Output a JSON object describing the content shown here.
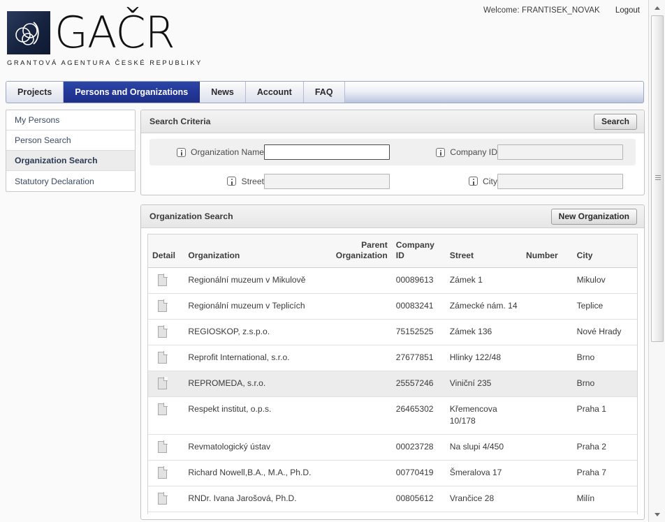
{
  "topbar": {
    "welcome_text": "Welcome: FRANTISEK_NOVAK",
    "logout_label": "Logout"
  },
  "branding": {
    "wordmark": "GAČR",
    "subtitle": "GRANTOVÁ AGENTURA ČESKÉ REPUBLIKY",
    "logo_bg": "#16233f"
  },
  "nav": {
    "active_tab_color": "#23379a",
    "tabs": [
      {
        "label": "Projects",
        "active": false
      },
      {
        "label": "Persons and Organizations",
        "active": true
      },
      {
        "label": "News",
        "active": false
      },
      {
        "label": "Account",
        "active": false
      },
      {
        "label": "FAQ",
        "active": false
      }
    ]
  },
  "sidebar": {
    "items": [
      {
        "label": "My Persons",
        "selected": false
      },
      {
        "label": "Person Search",
        "selected": false
      },
      {
        "label": "Organization Search",
        "selected": true
      },
      {
        "label": "Statutory Declaration",
        "selected": false
      }
    ]
  },
  "search_criteria": {
    "title": "Search Criteria",
    "search_button": "Search",
    "fields": {
      "organization_name": {
        "label": "Organization Name",
        "value": "",
        "placeholder": ""
      },
      "company_id": {
        "label": "Company ID",
        "value": "",
        "placeholder": ""
      },
      "street": {
        "label": "Street",
        "value": "",
        "placeholder": ""
      },
      "city": {
        "label": "City",
        "value": "",
        "placeholder": ""
      }
    }
  },
  "results": {
    "title": "Organization Search",
    "new_button": "New Organization",
    "columns": [
      "Detail",
      "Organization",
      "Parent Organization",
      "Company ID",
      "Street",
      "Number",
      "City"
    ],
    "rows": [
      {
        "detail_icon": "document-icon",
        "organization": "Regionální muzeum v Mikulově",
        "parent_organization": "",
        "company_id": "00089613",
        "street": "Zámek 1",
        "number": "",
        "city": "Mikulov",
        "highlight": false
      },
      {
        "detail_icon": "document-icon",
        "organization": "Regionální muzeum v Teplicích",
        "parent_organization": "",
        "company_id": "00083241",
        "street": "Zámecké nám. 14",
        "number": "",
        "city": "Teplice",
        "highlight": false
      },
      {
        "detail_icon": "document-icon",
        "organization": "REGIOSKOP, z.s.p.o.",
        "parent_organization": "",
        "company_id": "75152525",
        "street": "Zámek 136",
        "number": "",
        "city": "Nové Hrady",
        "highlight": false
      },
      {
        "detail_icon": "document-icon",
        "organization": "Reprofit International, s.r.o.",
        "parent_organization": "",
        "company_id": "27677851",
        "street": "Hlinky 122/48",
        "number": "",
        "city": "Brno",
        "highlight": false
      },
      {
        "detail_icon": "document-icon",
        "organization": "REPROMEDA, s.r.o.",
        "parent_organization": "",
        "company_id": "25557246",
        "street": "Viniční 235",
        "number": "",
        "city": "Brno",
        "highlight": true
      },
      {
        "detail_icon": "document-icon",
        "organization": "Respekt institut, o.p.s.",
        "parent_organization": "",
        "company_id": "26465302",
        "street": "Křemencova 10/178",
        "number": "",
        "city": "Praha 1",
        "highlight": false
      },
      {
        "detail_icon": "document-icon",
        "organization": "Revmatologický ústav",
        "parent_organization": "",
        "company_id": "00023728",
        "street": "Na slupi 4/450",
        "number": "",
        "city": "Praha 2",
        "highlight": false
      },
      {
        "detail_icon": "document-icon",
        "organization": "Richard Nowell,B.A., M.A., Ph.D.",
        "parent_organization": "",
        "company_id": "00770419",
        "street": "Šmeralova 17",
        "number": "",
        "city": "Praha 7",
        "highlight": false
      },
      {
        "detail_icon": "document-icon",
        "organization": "RNDr. Ivana Jarošová, Ph.D.",
        "parent_organization": "",
        "company_id": "00805612",
        "street": "Vrančice 28",
        "number": "",
        "city": "Milín",
        "highlight": false
      }
    ]
  },
  "scrollbar": {
    "up_icon": "chevron-up-icon",
    "down_icon": "chevron-down-icon"
  }
}
